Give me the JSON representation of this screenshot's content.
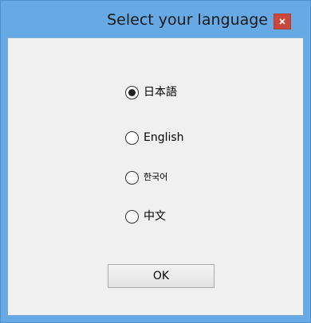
{
  "window": {
    "title": "Select your language",
    "close_label": "x",
    "title_bar_color": "#67a9e5",
    "close_button_color": "#c9483c"
  },
  "language_options": [
    {
      "label": "日本語",
      "selected": true
    },
    {
      "label": "English",
      "selected": false
    },
    {
      "label": "한국어",
      "selected": false
    },
    {
      "label": "中文",
      "selected": false
    }
  ],
  "ok_button": {
    "label": "OK"
  }
}
